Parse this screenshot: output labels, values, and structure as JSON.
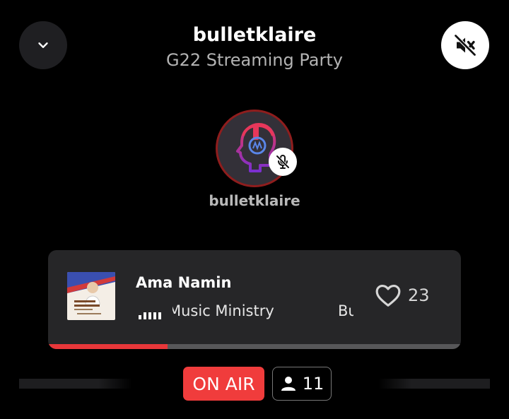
{
  "header": {
    "host_name": "bulletklaire",
    "room_title": "G22 Streaming Party"
  },
  "icons": {
    "collapse": "chevron-down-icon",
    "mute": "speaker-muted-icon",
    "mic": "mic-off-icon",
    "like": "heart-icon",
    "listeners": "person-icon"
  },
  "speaker": {
    "name": "bulletklaire"
  },
  "now_playing": {
    "title": "Ama Namin",
    "artist_marquee": "Music Ministry",
    "artist_marquee_next": "Bu",
    "likes": "23",
    "progress": 0.29
  },
  "status": {
    "on_air_label": "ON AIR",
    "listener_count": "11"
  },
  "colors": {
    "accent": "#f03c3c",
    "avatar_ring": "#8f1d1d",
    "card_bg": "#262628"
  }
}
